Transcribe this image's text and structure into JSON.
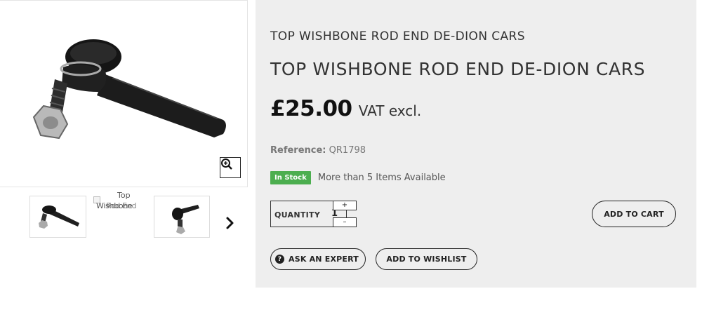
{
  "gallery": {
    "main_image_alt": "Top Wishbone Rod End",
    "zoom_icon": "zoom-in-icon",
    "thumbnails": [
      {
        "alt": "Top Wishbone Rod End"
      },
      {
        "alt_line1": "Top",
        "alt_line2": "Wishbone",
        "alt_line3": "Rod End",
        "broken": true
      },
      {
        "alt": "Top Wishbone Rod End"
      }
    ],
    "next_icon": "chevron-right-icon"
  },
  "product": {
    "breadcrumb_title": "TOP WISHBONE ROD END DE-DION CARS",
    "title": "TOP WISHBONE ROD END DE-DION CARS",
    "price": "£25.00",
    "vat_label": "VAT excl.",
    "reference_label": "Reference:",
    "reference_value": "QR1798",
    "stock_badge": "In Stock",
    "availability": "More than 5 Items Available"
  },
  "quantity": {
    "label": "QUANTITY",
    "value": "1",
    "plus": "+",
    "minus": "–"
  },
  "actions": {
    "add_to_cart": "ADD TO CART",
    "ask_expert": "ASK AN EXPERT",
    "ask_expert_icon": "question-circle-icon",
    "add_to_wishlist": "ADD TO WISHLIST"
  },
  "colors": {
    "panel_bg": "#eeeeee",
    "stock_green": "#4cae4f",
    "text_dark": "#222222"
  }
}
